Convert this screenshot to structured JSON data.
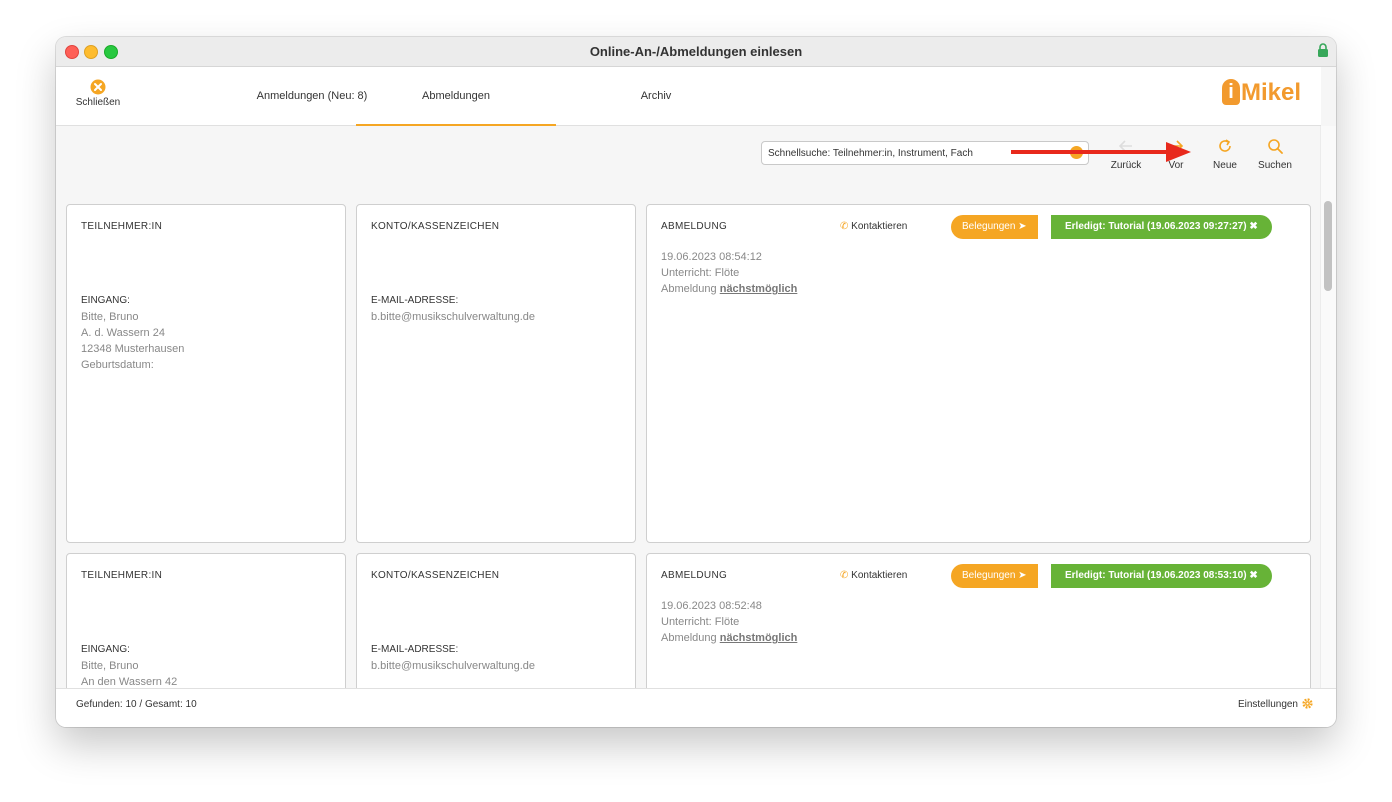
{
  "window": {
    "title": "Online-An-/Abmeldungen einlesen"
  },
  "toolbar": {
    "close_label": "Schließen",
    "tabs": [
      {
        "label": "Anmeldungen (Neu: 8)"
      },
      {
        "label": "Abmeldungen",
        "active": true
      },
      {
        "label": "Archiv"
      }
    ],
    "logo": "iMikel"
  },
  "search": {
    "placeholder": "Schnellsuche: Teilnehmer:in, Instrument, Fach",
    "buttons": {
      "back": "Zurück",
      "forward": "Vor",
      "new": "Neue",
      "search": "Suchen"
    }
  },
  "records": [
    {
      "participant_header": "TEILNEHMER:IN",
      "entry_label": "EINGANG:",
      "entry_lines": [
        "Bitte, Bruno",
        "A. d. Wassern 24",
        "12348 Musterhausen",
        "Geburtsdatum:"
      ],
      "account_header": "KONTO/KASSENZEICHEN",
      "email_label": "E-MAIL-ADRESSE:",
      "email": "b.bitte@musikschulverwaltung.de",
      "cancel_header": "ABMELDUNG",
      "contact": "Kontaktieren",
      "bookings": "Belegungen",
      "done": "Erledigt: Tutorial (19.06.2023 09:27:27)",
      "date": "19.06.2023 08:54:12",
      "lesson": "Unterricht: Flöte",
      "cancel_prefix": "Abmeldung",
      "cancel_when": "nächstmöglich"
    },
    {
      "participant_header": "TEILNEHMER:IN",
      "entry_label": "EINGANG:",
      "entry_lines": [
        "Bitte, Bruno",
        "An den Wassern 42"
      ],
      "account_header": "KONTO/KASSENZEICHEN",
      "email_label": "E-MAIL-ADRESSE:",
      "email": "b.bitte@musikschulverwaltung.de",
      "cancel_header": "ABMELDUNG",
      "contact": "Kontaktieren",
      "bookings": "Belegungen",
      "done": "Erledigt: Tutorial (19.06.2023 08:53:10)",
      "date": "19.06.2023 08:52:48",
      "lesson": "Unterricht: Flöte",
      "cancel_prefix": "Abmeldung",
      "cancel_when": "nächstmöglich"
    }
  ],
  "status": {
    "found": "Gefunden: 10 / Gesamt: 10",
    "settings": "Einstellungen"
  },
  "colors": {
    "accent": "#f5a623",
    "done_green": "#67b337",
    "annotation_arrow": "#e8291c"
  },
  "icons": [
    "close-circle-icon",
    "back-arrow-icon",
    "forward-arrow-icon",
    "refresh-icon",
    "search-icon",
    "phone-icon",
    "arrow-circle-right-icon",
    "close-x-icon",
    "gear-icon",
    "lock-icon"
  ]
}
